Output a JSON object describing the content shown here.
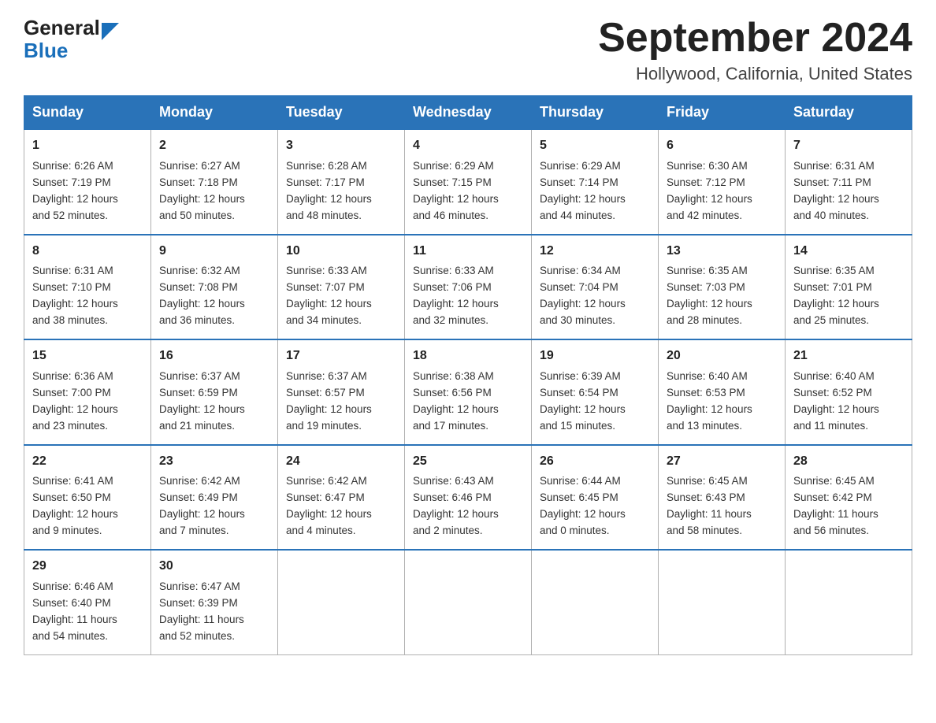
{
  "header": {
    "title": "September 2024",
    "subtitle": "Hollywood, California, United States"
  },
  "logo": {
    "general": "General",
    "blue": "Blue"
  },
  "days": [
    "Sunday",
    "Monday",
    "Tuesday",
    "Wednesday",
    "Thursday",
    "Friday",
    "Saturday"
  ],
  "weeks": [
    [
      {
        "date": "1",
        "info": "Sunrise: 6:26 AM\nSunset: 7:19 PM\nDaylight: 12 hours\nand 52 minutes."
      },
      {
        "date": "2",
        "info": "Sunrise: 6:27 AM\nSunset: 7:18 PM\nDaylight: 12 hours\nand 50 minutes."
      },
      {
        "date": "3",
        "info": "Sunrise: 6:28 AM\nSunset: 7:17 PM\nDaylight: 12 hours\nand 48 minutes."
      },
      {
        "date": "4",
        "info": "Sunrise: 6:29 AM\nSunset: 7:15 PM\nDaylight: 12 hours\nand 46 minutes."
      },
      {
        "date": "5",
        "info": "Sunrise: 6:29 AM\nSunset: 7:14 PM\nDaylight: 12 hours\nand 44 minutes."
      },
      {
        "date": "6",
        "info": "Sunrise: 6:30 AM\nSunset: 7:12 PM\nDaylight: 12 hours\nand 42 minutes."
      },
      {
        "date": "7",
        "info": "Sunrise: 6:31 AM\nSunset: 7:11 PM\nDaylight: 12 hours\nand 40 minutes."
      }
    ],
    [
      {
        "date": "8",
        "info": "Sunrise: 6:31 AM\nSunset: 7:10 PM\nDaylight: 12 hours\nand 38 minutes."
      },
      {
        "date": "9",
        "info": "Sunrise: 6:32 AM\nSunset: 7:08 PM\nDaylight: 12 hours\nand 36 minutes."
      },
      {
        "date": "10",
        "info": "Sunrise: 6:33 AM\nSunset: 7:07 PM\nDaylight: 12 hours\nand 34 minutes."
      },
      {
        "date": "11",
        "info": "Sunrise: 6:33 AM\nSunset: 7:06 PM\nDaylight: 12 hours\nand 32 minutes."
      },
      {
        "date": "12",
        "info": "Sunrise: 6:34 AM\nSunset: 7:04 PM\nDaylight: 12 hours\nand 30 minutes."
      },
      {
        "date": "13",
        "info": "Sunrise: 6:35 AM\nSunset: 7:03 PM\nDaylight: 12 hours\nand 28 minutes."
      },
      {
        "date": "14",
        "info": "Sunrise: 6:35 AM\nSunset: 7:01 PM\nDaylight: 12 hours\nand 25 minutes."
      }
    ],
    [
      {
        "date": "15",
        "info": "Sunrise: 6:36 AM\nSunset: 7:00 PM\nDaylight: 12 hours\nand 23 minutes."
      },
      {
        "date": "16",
        "info": "Sunrise: 6:37 AM\nSunset: 6:59 PM\nDaylight: 12 hours\nand 21 minutes."
      },
      {
        "date": "17",
        "info": "Sunrise: 6:37 AM\nSunset: 6:57 PM\nDaylight: 12 hours\nand 19 minutes."
      },
      {
        "date": "18",
        "info": "Sunrise: 6:38 AM\nSunset: 6:56 PM\nDaylight: 12 hours\nand 17 minutes."
      },
      {
        "date": "19",
        "info": "Sunrise: 6:39 AM\nSunset: 6:54 PM\nDaylight: 12 hours\nand 15 minutes."
      },
      {
        "date": "20",
        "info": "Sunrise: 6:40 AM\nSunset: 6:53 PM\nDaylight: 12 hours\nand 13 minutes."
      },
      {
        "date": "21",
        "info": "Sunrise: 6:40 AM\nSunset: 6:52 PM\nDaylight: 12 hours\nand 11 minutes."
      }
    ],
    [
      {
        "date": "22",
        "info": "Sunrise: 6:41 AM\nSunset: 6:50 PM\nDaylight: 12 hours\nand 9 minutes."
      },
      {
        "date": "23",
        "info": "Sunrise: 6:42 AM\nSunset: 6:49 PM\nDaylight: 12 hours\nand 7 minutes."
      },
      {
        "date": "24",
        "info": "Sunrise: 6:42 AM\nSunset: 6:47 PM\nDaylight: 12 hours\nand 4 minutes."
      },
      {
        "date": "25",
        "info": "Sunrise: 6:43 AM\nSunset: 6:46 PM\nDaylight: 12 hours\nand 2 minutes."
      },
      {
        "date": "26",
        "info": "Sunrise: 6:44 AM\nSunset: 6:45 PM\nDaylight: 12 hours\nand 0 minutes."
      },
      {
        "date": "27",
        "info": "Sunrise: 6:45 AM\nSunset: 6:43 PM\nDaylight: 11 hours\nand 58 minutes."
      },
      {
        "date": "28",
        "info": "Sunrise: 6:45 AM\nSunset: 6:42 PM\nDaylight: 11 hours\nand 56 minutes."
      }
    ],
    [
      {
        "date": "29",
        "info": "Sunrise: 6:46 AM\nSunset: 6:40 PM\nDaylight: 11 hours\nand 54 minutes."
      },
      {
        "date": "30",
        "info": "Sunrise: 6:47 AM\nSunset: 6:39 PM\nDaylight: 11 hours\nand 52 minutes."
      },
      null,
      null,
      null,
      null,
      null
    ]
  ]
}
